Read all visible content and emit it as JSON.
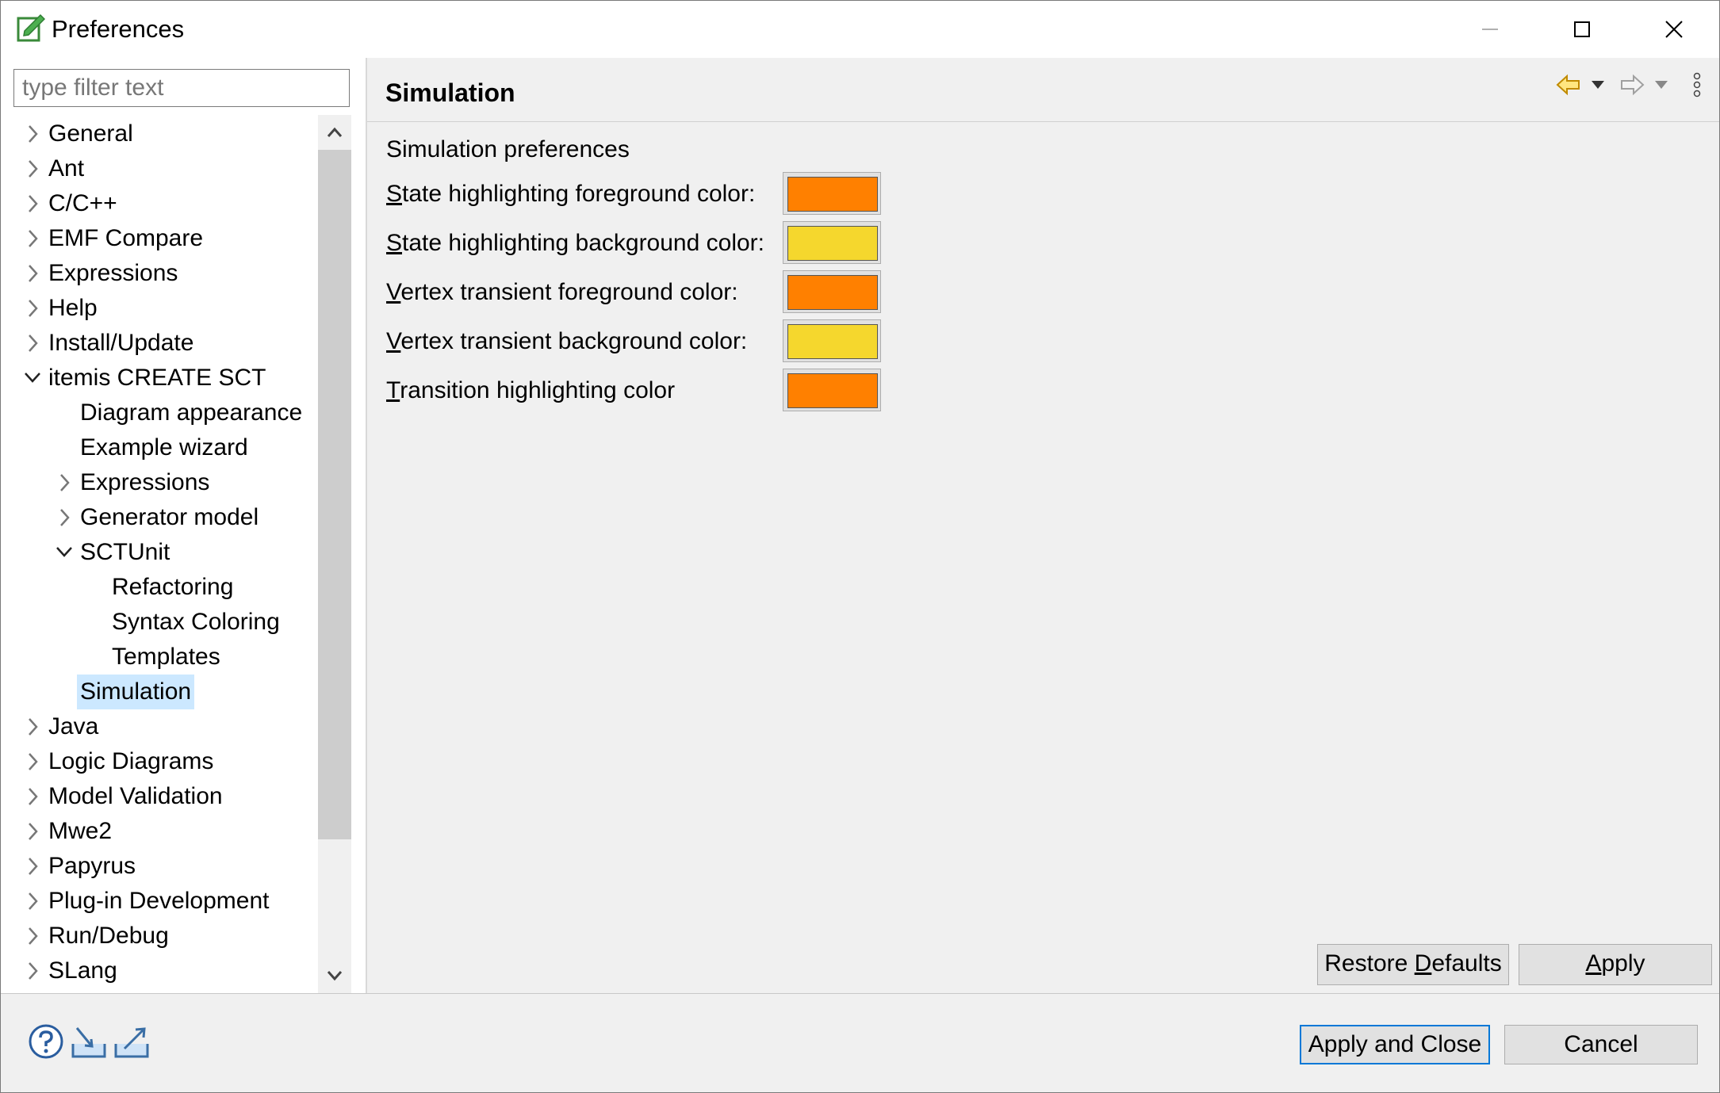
{
  "window": {
    "title": "Preferences"
  },
  "filter": {
    "placeholder": "type filter text"
  },
  "tree": [
    {
      "label": "General",
      "level": 0,
      "expander": "collapsed"
    },
    {
      "label": "Ant",
      "level": 0,
      "expander": "collapsed"
    },
    {
      "label": "C/C++",
      "level": 0,
      "expander": "collapsed"
    },
    {
      "label": "EMF Compare",
      "level": 0,
      "expander": "collapsed"
    },
    {
      "label": "Expressions",
      "level": 0,
      "expander": "collapsed"
    },
    {
      "label": "Help",
      "level": 0,
      "expander": "collapsed"
    },
    {
      "label": "Install/Update",
      "level": 0,
      "expander": "collapsed"
    },
    {
      "label": "itemis CREATE SCT",
      "level": 0,
      "expander": "expanded"
    },
    {
      "label": "Diagram appearance",
      "level": 1,
      "expander": "none"
    },
    {
      "label": "Example wizard",
      "level": 1,
      "expander": "none"
    },
    {
      "label": "Expressions",
      "level": 1,
      "expander": "collapsed"
    },
    {
      "label": "Generator model",
      "level": 1,
      "expander": "collapsed"
    },
    {
      "label": "SCTUnit",
      "level": 1,
      "expander": "expanded"
    },
    {
      "label": "Refactoring",
      "level": 2,
      "expander": "none"
    },
    {
      "label": "Syntax Coloring",
      "level": 2,
      "expander": "none"
    },
    {
      "label": "Templates",
      "level": 2,
      "expander": "none"
    },
    {
      "label": "Simulation",
      "level": 1,
      "expander": "none",
      "selected": true
    },
    {
      "label": "Java",
      "level": 0,
      "expander": "collapsed"
    },
    {
      "label": "Logic Diagrams",
      "level": 0,
      "expander": "collapsed"
    },
    {
      "label": "Model Validation",
      "level": 0,
      "expander": "collapsed"
    },
    {
      "label": "Mwe2",
      "level": 0,
      "expander": "collapsed"
    },
    {
      "label": "Papyrus",
      "level": 0,
      "expander": "collapsed"
    },
    {
      "label": "Plug-in Development",
      "level": 0,
      "expander": "collapsed"
    },
    {
      "label": "Run/Debug",
      "level": 0,
      "expander": "collapsed"
    },
    {
      "label": "SLang",
      "level": 0,
      "expander": "collapsed"
    }
  ],
  "page": {
    "title": "Simulation",
    "section_label": "Simulation preferences",
    "preferences": [
      {
        "mnemonic": "S",
        "rest": "tate highlighting foreground color:",
        "color": "#ff8000"
      },
      {
        "mnemonic": "S",
        "rest": "tate highlighting background color:",
        "color": "#f5d72d"
      },
      {
        "mnemonic": "V",
        "rest": "ertex transient foreground color:",
        "color": "#ff8000"
      },
      {
        "mnemonic": "V",
        "rest": "ertex transient background color:",
        "color": "#f5d72d"
      },
      {
        "mnemonic": "T",
        "rest": "ransition highlighting color",
        "color": "#ff8000"
      }
    ],
    "restore_defaults": {
      "before": "Restore ",
      "mnemonic": "D",
      "after": "efaults"
    },
    "apply": {
      "mnemonic": "A",
      "after": "pply"
    }
  },
  "footer": {
    "apply_and_close": "Apply and Close",
    "cancel": "Cancel"
  },
  "colors": {
    "selection": "#cce8ff",
    "default_button_border": "#0078d7",
    "orange": "#ff8000",
    "yellow": "#f5d72d"
  }
}
